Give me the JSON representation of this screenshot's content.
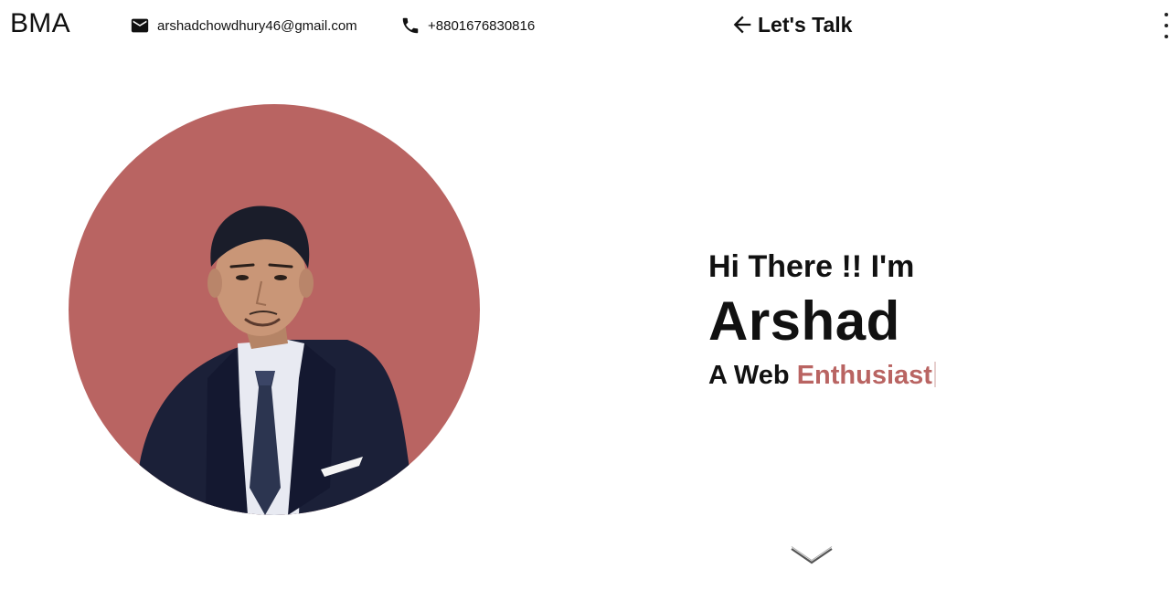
{
  "header": {
    "brand": "BMA",
    "email": "arshadchowdhury46@gmail.com",
    "phone": "+8801676830816",
    "cta_label": "Let's Talk",
    "icons": {
      "email": "mail-icon",
      "phone": "phone-icon",
      "cta": "arrow-left-icon",
      "menu": "more-vert-icon"
    }
  },
  "hero": {
    "greeting": "Hi There !! I'm",
    "name": "Arshad",
    "tagline_prefix": "A Web",
    "tagline_accent": "Enthusiast"
  },
  "scroll": {
    "icon": "chevron-down-icon"
  },
  "colors": {
    "accent": "#b96462",
    "text": "#111111",
    "background": "#ffffff"
  }
}
